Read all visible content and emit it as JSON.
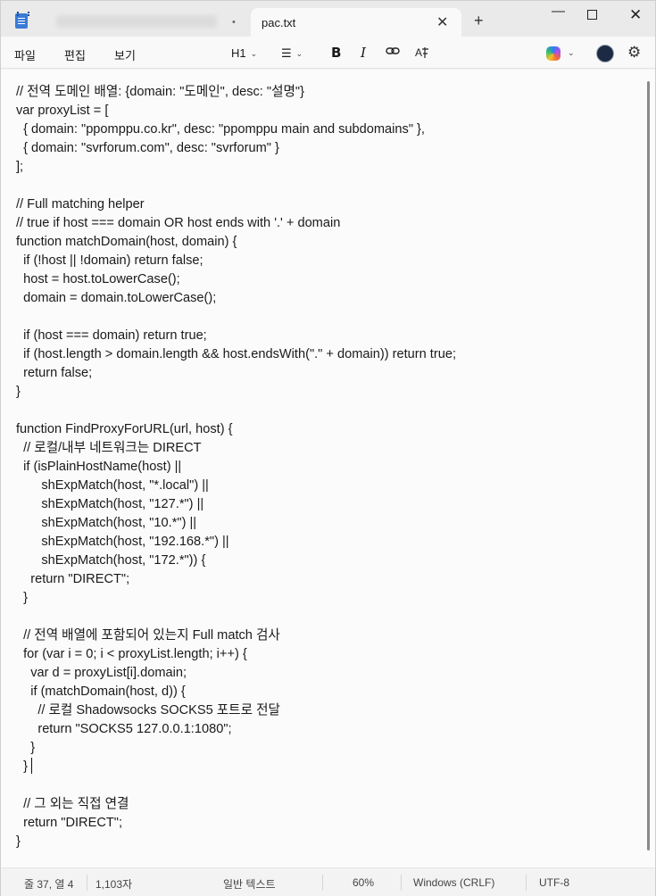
{
  "tabs": {
    "active_title": "pac.txt",
    "inactive_modified_marker": "•",
    "close_glyph": "✕",
    "new_tab_glyph": "+"
  },
  "window_controls": {
    "minimize": "—",
    "close": "✕"
  },
  "menu": {
    "file": "파일",
    "edit": "편집",
    "view": "보기"
  },
  "toolbar": {
    "heading": "H1",
    "list_glyph": "☰",
    "bold": "B",
    "italic": "I",
    "link_glyph": "🔗",
    "spell_glyph": "A̶",
    "chevron": "⌄",
    "settings_glyph": "⚙"
  },
  "icons": {
    "app": "notepad-icon",
    "copilot": "copilot-icon",
    "avatar": "user-avatar",
    "settings": "gear-icon"
  },
  "editor": {
    "lines": [
      "// 전역 도메인 배열: {domain: \"도메인\", desc: \"설명\"}",
      "var proxyList = [",
      "  { domain: \"ppomppu.co.kr\", desc: \"ppomppu main and subdomains\" },",
      "  { domain: \"svrforum.com\", desc: \"svrforum\" }",
      "];",
      "",
      "// Full matching helper",
      "// true if host === domain OR host ends with '.' + domain",
      "function matchDomain(host, domain) {",
      "  if (!host || !domain) return false;",
      "  host = host.toLowerCase();",
      "  domain = domain.toLowerCase();",
      "",
      "  if (host === domain) return true;",
      "  if (host.length > domain.length && host.endsWith(\".\" + domain)) return true;",
      "  return false;",
      "}",
      "",
      "function FindProxyForURL(url, host) {",
      "  // 로컬/내부 네트워크는 DIRECT",
      "  if (isPlainHostName(host) ||",
      "       shExpMatch(host, \"*.local\") ||",
      "       shExpMatch(host, \"127.*\") ||",
      "       shExpMatch(host, \"10.*\") ||",
      "       shExpMatch(host, \"192.168.*\") ||",
      "       shExpMatch(host, \"172.*\")) {",
      "    return \"DIRECT\";",
      "  }",
      "",
      "  // 전역 배열에 포함되어 있는지 Full match 검사",
      "  for (var i = 0; i < proxyList.length; i++) {",
      "    var d = proxyList[i].domain;",
      "    if (matchDomain(host, d)) {",
      "      // 로컬 Shadowsocks SOCKS5 포트로 전달",
      "      return \"SOCKS5 127.0.0.1:1080\";",
      "    }",
      "  }",
      "",
      "  // 그 외는 직접 연결",
      "  return \"DIRECT\";",
      "}"
    ]
  },
  "status": {
    "position": "줄 37, 열 4",
    "chars": "1,103자",
    "format": "일반 텍스트",
    "zoom": "60%",
    "line_ending": "Windows (CRLF)",
    "encoding": "UTF-8"
  }
}
